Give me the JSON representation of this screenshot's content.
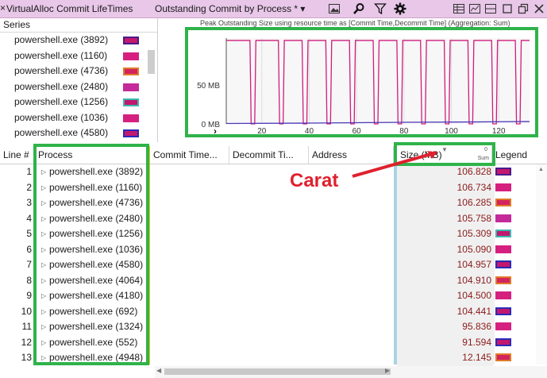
{
  "toolbar": {
    "close": "×",
    "title": "VirtualAlloc Commit LifeTimes",
    "view": "Outstanding Commit by Process *",
    "view_arrow": "▾"
  },
  "series": {
    "header": "Series",
    "items": [
      {
        "label": "powershell.exe (3892)",
        "fill": "#c2186e",
        "border": "#4a1a8a"
      },
      {
        "label": "powershell.exe (1160)",
        "fill": "#d6207f",
        "border": "#d6207f"
      },
      {
        "label": "powershell.exe (4736)",
        "fill": "#d2245e",
        "border": "#e07b2a"
      },
      {
        "label": "powershell.exe (2480)",
        "fill": "#c42a9a",
        "border": "#c42a9a"
      },
      {
        "label": "powershell.exe (1256)",
        "fill": "#c2186e",
        "border": "#3bb8b0"
      },
      {
        "label": "powershell.exe (1036)",
        "fill": "#d6207f",
        "border": "#d6207f"
      },
      {
        "label": "powershell.exe (4580)",
        "fill": "#c2186e",
        "border": "#2a2ab8"
      }
    ]
  },
  "chart_data": {
    "type": "line",
    "title": "Peak Outstanding Size using resource time as [Commit Time,Decommit Time] (Aggregation: Sum)",
    "y_ticks": [
      "50 MB",
      "0 MB"
    ],
    "x_ticks": [
      "20",
      "40",
      "60",
      "80",
      "100",
      "120"
    ],
    "xlim": [
      5,
      133
    ],
    "ylim": [
      0,
      110
    ],
    "series": [
      {
        "color": "#d01c7c",
        "x": [
          5,
          15,
          15.5,
          17,
          17.5,
          27,
          27.5,
          29,
          29.5,
          37,
          37.5,
          39,
          39.5,
          47,
          47.5,
          49,
          49.5,
          57,
          57.5,
          59,
          59.5,
          67,
          67.5,
          69,
          69.5,
          77,
          77.5,
          79,
          79.5,
          87,
          87.5,
          89,
          89.5,
          97,
          97.5,
          99,
          99.5,
          107,
          107.5,
          109,
          109.5,
          117,
          117.5,
          119,
          119.5,
          127,
          127.5,
          129,
          129.5,
          133
        ],
        "y": [
          107,
          107,
          0,
          0,
          107,
          107,
          0,
          0,
          107,
          107,
          0,
          0,
          107,
          107,
          0,
          0,
          107,
          107,
          0,
          0,
          107,
          107,
          0,
          0,
          107,
          107,
          0,
          0,
          107,
          107,
          0,
          0,
          107,
          107,
          0,
          0,
          107,
          107,
          0,
          0,
          107,
          107,
          0,
          0,
          107,
          107,
          0,
          0,
          107,
          107
        ]
      },
      {
        "color": "#4a3ab8",
        "x": [
          5,
          40,
          80,
          110,
          133
        ],
        "y": [
          0.5,
          1,
          2,
          2.5,
          3
        ]
      }
    ]
  },
  "table": {
    "columns": [
      "Line #",
      "Process",
      "Commit Time...",
      "Decommit Ti...",
      "Address",
      "Size (MB)",
      "Legend"
    ],
    "size_sub_top": "0",
    "size_sub_bottom": "Sum",
    "rows": [
      {
        "line": "1",
        "process": "powershell.exe (3892)",
        "size": "106.828",
        "fill": "#c2186e",
        "border": "#4a1a8a"
      },
      {
        "line": "2",
        "process": "powershell.exe (1160)",
        "size": "106.734",
        "fill": "#d6207f",
        "border": "#d6207f"
      },
      {
        "line": "3",
        "process": "powershell.exe (4736)",
        "size": "106.285",
        "fill": "#d2245e",
        "border": "#e07b2a"
      },
      {
        "line": "4",
        "process": "powershell.exe (2480)",
        "size": "105.758",
        "fill": "#c42a9a",
        "border": "#c42a9a"
      },
      {
        "line": "5",
        "process": "powershell.exe (1256)",
        "size": "105.309",
        "fill": "#c2186e",
        "border": "#3bb8b0"
      },
      {
        "line": "6",
        "process": "powershell.exe (1036)",
        "size": "105.090",
        "fill": "#d6207f",
        "border": "#d6207f"
      },
      {
        "line": "7",
        "process": "powershell.exe (4580)",
        "size": "104.957",
        "fill": "#c2186e",
        "border": "#2a2ab8"
      },
      {
        "line": "8",
        "process": "powershell.exe (4064)",
        "size": "104.910",
        "fill": "#d2245e",
        "border": "#e07b2a"
      },
      {
        "line": "9",
        "process": "powershell.exe (4180)",
        "size": "104.500",
        "fill": "#d6207f",
        "border": "#d6207f"
      },
      {
        "line": "10",
        "process": "powershell.exe (692)",
        "size": "104.441",
        "fill": "#c2186e",
        "border": "#2a2ab8"
      },
      {
        "line": "11",
        "process": "powershell.exe (1324)",
        "size": "95.836",
        "fill": "#d6207f",
        "border": "#d6207f"
      },
      {
        "line": "12",
        "process": "powershell.exe (552)",
        "size": "91.594",
        "fill": "#c2186e",
        "border": "#2a2ab8"
      },
      {
        "line": "13",
        "process": "powershell.exe (4948)",
        "size": "12.145",
        "fill": "#d2245e",
        "border": "#e07b2a"
      }
    ]
  },
  "annotation": {
    "label": "Carat",
    "color": "#e0202e",
    "highlight": "#2fb34a"
  }
}
